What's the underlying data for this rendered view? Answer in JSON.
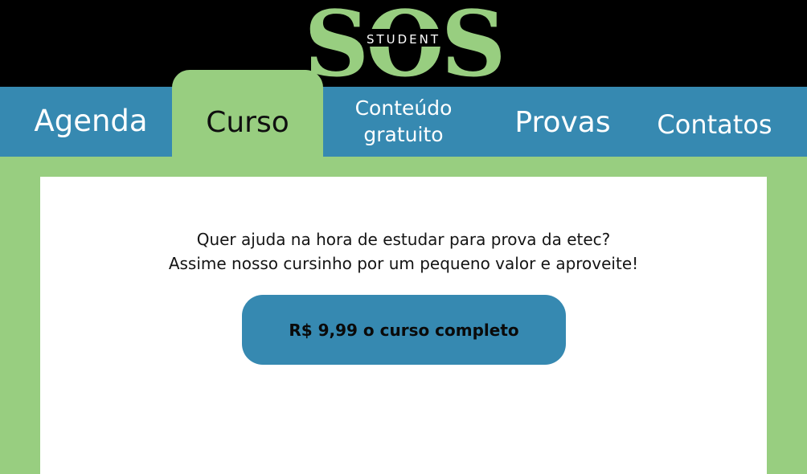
{
  "brand": {
    "logo_main": "SOS",
    "logo_sub": "STUDENT",
    "colors": {
      "header_bg": "#000000",
      "logo_green": "#98ce80",
      "nav_blue": "#3689b1",
      "page_green": "#98ce80"
    }
  },
  "nav": {
    "items": [
      {
        "label": "Agenda"
      },
      {
        "label": "Curso",
        "active": true
      },
      {
        "label_line1": "Conteúdo",
        "label_line2": "gratuito"
      },
      {
        "label": "Provas"
      },
      {
        "label": "Contatos"
      }
    ]
  },
  "main": {
    "promo_line1": "Quer ajuda na hora de estudar para prova da etec?",
    "promo_line2": "Assime nosso cursinho por um pequeno valor e aproveite!",
    "buy_button_label": "R$ 9,99 o curso completo"
  }
}
